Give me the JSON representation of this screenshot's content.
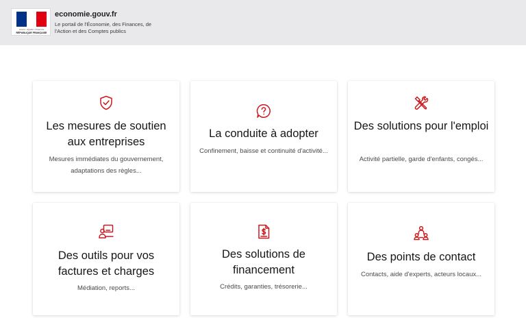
{
  "header": {
    "logo": {
      "motto": "Liberté • Égalité • Fraternité",
      "republic": "RÉPUBLIQUE FRANÇAISE"
    },
    "site_name": "economie.gouv.fr",
    "tagline": "Le portail de l'Économie, des Finances, de l'Action et des Comptes publics"
  },
  "colors": {
    "accent": "#c9191e",
    "header_bg": "#e9e9ec",
    "flag_blue": "#003189",
    "flag_red": "#e1000f"
  },
  "cards": [
    {
      "icon": "shield-check-icon",
      "title": "Les mesures de soutien aux entreprises",
      "description": "Mesures immédiates du gouvernement, adaptations des règles..."
    },
    {
      "icon": "question-bubble-icon",
      "title": "La conduite à adopter",
      "description": "Confinement, baisse et continuité d'activité..."
    },
    {
      "icon": "tools-icon",
      "title": "Des solutions pour l'emploi",
      "description": "Activité partielle, garde d'enfants, congés..."
    },
    {
      "icon": "user-screen-icon",
      "title": "Des outils pour vos factures et charges",
      "description": "Médiation, reports..."
    },
    {
      "icon": "invoice-dollar-icon",
      "title": "Des solutions de financement",
      "description": "Crédits, garanties, trésorerie..."
    },
    {
      "icon": "contacts-network-icon",
      "title": "Des points de contact",
      "description": "Contacts, aide d'experts, acteurs locaux..."
    }
  ]
}
